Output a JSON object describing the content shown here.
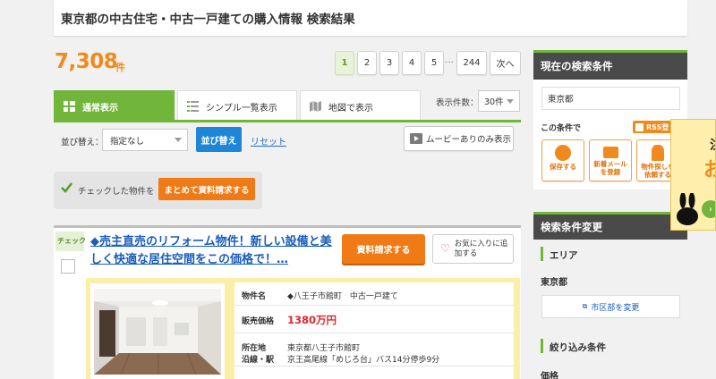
{
  "header": {
    "title": "東京都の中古住宅・中古一戸建ての購入情報 検索結果"
  },
  "results": {
    "count": "7,308",
    "count_unit": "件"
  },
  "pagination": {
    "pages": [
      "1",
      "2",
      "3",
      "4",
      "5"
    ],
    "ellipsis": "…",
    "last": "244",
    "next": "次へ",
    "current": "1"
  },
  "view_tabs": [
    {
      "label": "通常表示",
      "icon": "grid-icon",
      "active": true
    },
    {
      "label": "シンプル一覧表示",
      "icon": "list-icon",
      "active": false
    },
    {
      "label": "地図で表示",
      "icon": "map-icon",
      "active": false
    }
  ],
  "display_count": {
    "label": "表示件数：",
    "value": "30件"
  },
  "sort": {
    "label": "並び替え：",
    "value": "指定なし",
    "button": "並び替え",
    "reset": "リセット"
  },
  "movie_filter": {
    "label": "ムービーありのみ表示"
  },
  "bulk": {
    "text": "チェックした物件を",
    "button": "まとめて資料請求する"
  },
  "listing": {
    "check_tag": "チェック",
    "title": "◆売主直売のリフォーム物件！新しい設備と美しく快適な居住空間をこの価格で！…",
    "request_button": "資料請求する",
    "favorite_button": "お気に入りに追加する",
    "specs": {
      "name_key": "物件名",
      "name_val": "◆八王子市館町　中古一戸建て",
      "price_key": "販売価格",
      "price_val": "1380万円",
      "loc_key": "所在地",
      "loc_val": "東京都八王子市館町",
      "line_key": "沿線・駅",
      "line_val": "京王高尾線「めじろ台」バス14分停歩9分"
    }
  },
  "sidebar": {
    "current_title": "現在の検索条件",
    "current_value": "東京都",
    "cond_label": "この条件で",
    "rss": "RSS登",
    "actions": [
      {
        "label": "保存する",
        "icon": "save-icon"
      },
      {
        "label": "新着メールを登録",
        "icon": "mail-icon"
      },
      {
        "label": "物件探しを依頼する",
        "icon": "person-icon"
      }
    ],
    "change_title": "検索条件変更",
    "area_label": "エリア",
    "pref": "東京都",
    "city_button": "市区部を変更",
    "filter_label": "絞り込み条件",
    "price_label": "価格"
  },
  "ad": {
    "glyph1": "注",
    "glyph2": "お"
  },
  "colors": {
    "brand_green": "#72b53b",
    "accent_orange": "#f07a15",
    "link_blue": "#1a5dbb",
    "price_red": "#e0262c"
  }
}
